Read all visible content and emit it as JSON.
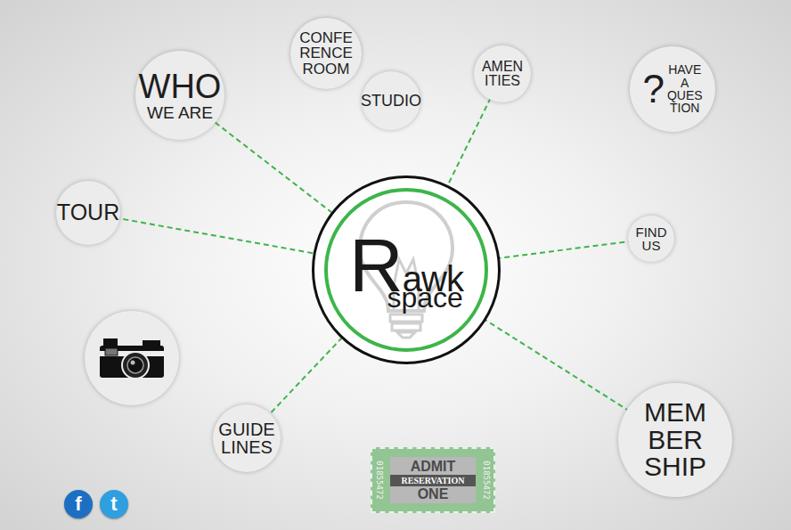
{
  "logo": {
    "name": "Rawk",
    "sub": "space"
  },
  "nodes": [
    {
      "kind": "text",
      "icon": "",
      "lines": [
        "WHO",
        "WE ARE"
      ],
      "linked": true
    },
    {
      "kind": "text",
      "icon": "",
      "lines": [
        "CONFE",
        "RENCE",
        "ROOM"
      ],
      "linked": false
    },
    {
      "kind": "text",
      "icon": "",
      "lines": [
        "STUDIO"
      ],
      "linked": false
    },
    {
      "kind": "text",
      "icon": "",
      "lines": [
        "AMEN",
        "ITIES"
      ],
      "linked": true
    },
    {
      "kind": "question",
      "icon": "?",
      "lines": [
        "HAVE",
        "A",
        "QUES",
        "TION"
      ],
      "linked": false
    },
    {
      "kind": "text",
      "icon": "",
      "lines": [
        "TOUR"
      ],
      "linked": true
    },
    {
      "kind": "text",
      "icon": "",
      "lines": [
        "FIND",
        "US"
      ],
      "linked": true
    },
    {
      "kind": "camera",
      "icon": "",
      "lines": [],
      "linked": false
    },
    {
      "kind": "text",
      "icon": "",
      "lines": [
        "GUIDE",
        "LINES"
      ],
      "linked": true
    },
    {
      "kind": "text",
      "icon": "",
      "lines": [
        "MEM",
        "BER",
        "SHIP"
      ],
      "linked": true
    }
  ],
  "ticket": {
    "top": "ADMIT",
    "middle": "RESERVATION",
    "bottom": "ONE",
    "serial_left": "01855472",
    "serial_right": "01855472"
  },
  "social": [
    {
      "label": "f",
      "color": "#1d6fc4"
    },
    {
      "label": "t",
      "color": "#2f9fe0"
    }
  ]
}
